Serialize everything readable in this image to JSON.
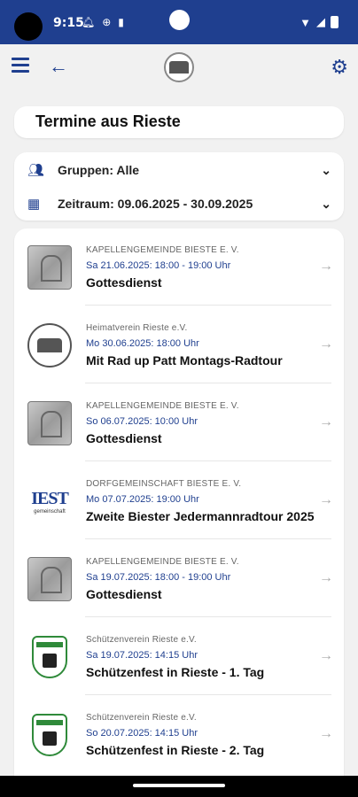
{
  "status": {
    "time": "9:15"
  },
  "header": {
    "title": "Termine aus Rieste"
  },
  "filters": {
    "groups_label": "Gruppen: Alle",
    "period_label": "Zeitraum: 09.06.2025 - 30.09.2025"
  },
  "events": [
    {
      "org": "KAPELLENGEMEINDE BIESTE E. V.",
      "date": "Sa 21.06.2025: 18:00 - 19:00 Uhr",
      "title": "Gottesdienst",
      "thumb": "chapel-stone"
    },
    {
      "org": "Heimatverein Rieste e.V.",
      "date": "Mo 30.06.2025: 18:00 Uhr",
      "title": "Mit Rad up Patt Montags-Radtour",
      "thumb": "round-emblem"
    },
    {
      "org": "KAPELLENGEMEINDE BIESTE E. V.",
      "date": "So 06.07.2025: 10:00 Uhr",
      "title": "Gottesdienst",
      "thumb": "chapel-stone"
    },
    {
      "org": "DORFGEMEINSCHAFT BIESTE E. V.",
      "date": "Mo 07.07.2025: 19:00 Uhr",
      "title": "Zweite Biester Jedermannradtour 2025",
      "thumb": "bieste-banner",
      "thumb_text": "IEST",
      "thumb_sub": "gemeinschaft"
    },
    {
      "org": "KAPELLENGEMEINDE BIESTE E. V.",
      "date": "Sa 19.07.2025: 18:00 - 19:00 Uhr",
      "title": "Gottesdienst",
      "thumb": "chapel-stone"
    },
    {
      "org": "Schützenverein Rieste e.V.",
      "date": "Sa 19.07.2025: 14:15 Uhr",
      "title": "Schützenfest in Rieste - 1. Tag",
      "thumb": "shield"
    },
    {
      "org": "Schützenverein Rieste e.V.",
      "date": "So 20.07.2025: 14:15 Uhr",
      "title": "Schützenfest in Rieste - 2. Tag",
      "thumb": "shield"
    }
  ],
  "colors": {
    "accent": "#1f3f8f",
    "background": "#f1f1f1"
  }
}
